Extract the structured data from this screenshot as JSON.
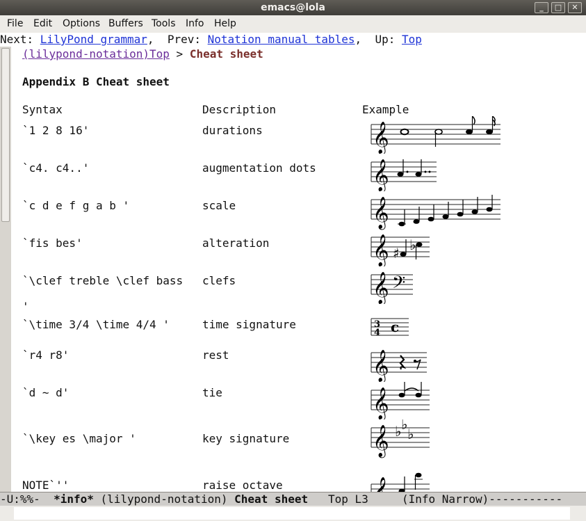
{
  "window": {
    "title": "emacs@lola",
    "minimize": "_",
    "maximize": "□",
    "close": "✕"
  },
  "menu": [
    "File",
    "Edit",
    "Options",
    "Buffers",
    "Tools",
    "Info",
    "Help"
  ],
  "header": {
    "next_label": "Next: ",
    "next_link": "LilyPond grammar",
    "sep1": ",  ",
    "prev_label": "Prev: ",
    "prev_link": "Notation manual tables",
    "sep2": ",  ",
    "up_label": "Up: ",
    "up_link": "Top"
  },
  "breadcrumb": {
    "link": "(lilypond-notation)Top",
    "sep": " > ",
    "current": "Cheat sheet"
  },
  "page": {
    "heading": "Appendix B Cheat sheet"
  },
  "table": {
    "columns": [
      "Syntax",
      "Description",
      "Example"
    ],
    "rows": [
      {
        "syntax": "`1 2 8 16'",
        "desc": "durations"
      },
      {
        "syntax": "`c4. c4..'",
        "desc": "augmentation dots"
      },
      {
        "syntax": "`c d e f g a b '",
        "desc": "scale"
      },
      {
        "syntax": "`fis bes'",
        "desc": "alteration"
      },
      {
        "syntax": "`\\clef treble \\clef bass",
        "desc": "clefs",
        "cont": "'"
      },
      {
        "syntax": "`\\time 3/4 \\time 4/4 '",
        "desc": "time signature"
      },
      {
        "syntax": "`r4 r8'",
        "desc": "rest"
      },
      {
        "syntax": "`d ~ d'",
        "desc": "tie"
      },
      {
        "syntax": "`\\key es \\major '",
        "desc": "key signature"
      },
      {
        "syntax": "NOTE`''",
        "desc": "raise octave"
      }
    ]
  },
  "modeline": {
    "status": "-U:%%-  ",
    "buffer": "*info*",
    "mid": " (lilypond-notation) ",
    "node": "Cheat sheet",
    "rest": "   Top L3     (Info Narrow)-----------"
  },
  "colors": {
    "link": "#1e33d6",
    "node": "#7a2f2b",
    "visited": "#6a2d9a"
  }
}
